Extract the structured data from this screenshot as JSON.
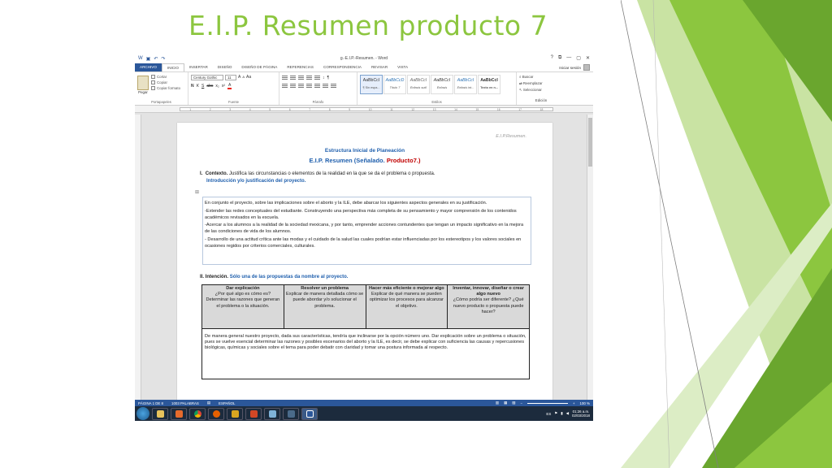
{
  "slide": {
    "title": "E.I.P. Resumen producto 7",
    "accent": "#8cc63f"
  },
  "word": {
    "doc_name": "g.-E.I.P.-Resumen. - Word",
    "win_ctrls": [
      "?",
      "⧉",
      "—",
      "▢",
      "✕"
    ],
    "tabs": [
      "ARCHIVO",
      "INICIO",
      "INSERTAR",
      "DISEÑO",
      "DISEÑO DE PÁGINA",
      "REFERENCIAS",
      "CORRESPONDENCIA",
      "REVISAR",
      "VISTA"
    ],
    "user": "Iniciar sesión",
    "ribbon": {
      "paste": "Pegar",
      "cut": "Cortar",
      "copy": "Copiar",
      "copy_format": "Copiar formato",
      "font_name": "Century Gothic",
      "font_size": "11",
      "groups": [
        "Portapapeles",
        "Fuente",
        "Párrafo",
        "Estilos",
        "Edición"
      ],
      "styles": [
        {
          "sample": "AaBbCcI",
          "name": "¶ Sin espa..."
        },
        {
          "sample": "AaBbCcD",
          "name": "Título 7"
        },
        {
          "sample": "AaBbCcI",
          "name": "Énfasis sutil"
        },
        {
          "sample": "AaBbCcI",
          "name": "Énfasis"
        },
        {
          "sample": "AaBbCcI",
          "name": "Énfasis int..."
        },
        {
          "sample": "AaBbCcI",
          "name": "Texto en n..."
        }
      ],
      "edit": [
        "Buscar",
        "Reemplazar",
        "Seleccionar"
      ]
    },
    "document": {
      "header_right": "E.I.P.Resumen.",
      "heading1": "Estructura Inicial de Planeación",
      "heading2_a": "E.I.P. Resumen (Señalado. ",
      "heading2_b": "Producto7.)",
      "section1_num": "I.",
      "section1_label": "Contexto.",
      "section1_text": "Justifica las circunstancias o elementos de la realidad en la que se da el problema o propuesta.",
      "section1_sub": "Introducción y/o justificación del proyecto.",
      "box_paragraphs": [
        "En conjunto el proyecto, sobre las implicaciones sobre el aborto y la ILE, debe abarcar los siguientes aspectos generales en su justificación.",
        "-Extender las redes conceptuales del estudiante. Construyendo una perspectiva más completa de su pensamiento y mayor comprensión de los contenidos académicos revisados en la escuela.",
        "-Acercar a los alumnos a la realidad de la sociedad mexicana, y por tanto, emprender acciones contundentes que tengan un impacto significativo en la mejora de las condiciones de vida de los alumnos.",
        "- Desarrollo de una actitud crítica ante las modas y el cuidado de la salud las cuales podrían estar influenciadas por los estereotipos y los valores sociales en ocasiones regidos por criterios comerciales, culturales."
      ],
      "section2_num": "II.",
      "section2_label": "Intención.",
      "section2_text": "Sólo una de las propuestas da nombre al proyecto.",
      "table_headers": [
        {
          "title": "Dar explicación",
          "text": "¿Por qué algo es cómo es? Determinar las razones que generan el problema o la situación."
        },
        {
          "title": "Resolver un problema",
          "text": "Explicar de manera detallada cómo se puede abordar y/o solucionar el problema."
        },
        {
          "title": "Hacer más eficiente o mejorar algo",
          "text": "Explicar de qué manera se pueden optimizar los procesos para alcanzar el objetivo."
        },
        {
          "title": "Inventar, innovar, diseñar o crear algo nuevo",
          "text": "¿Cómo podría ser diferente? ¿Qué nuevo producto o propuesta puede hacer?"
        }
      ],
      "table_body": "De manera general nuestro proyecto, dada sus características, tendría que inclinarse por la opción número uno. Dar explicación sobre un problema o situación, pues se vuelve esencial determinar las razones y posibles escenarios del aborto y la ILE, es decir, se debe explicar con suficiencia las causas y repercusiones biológicas, químicas y sociales sobre el tema para poder debatir con claridad y tomar una postura informada al respecto."
    },
    "status": {
      "page": "PÁGINA 1 DE 8",
      "words": "1003 PALABRAS",
      "lang": "ESPAÑOL",
      "zoom": "100 %"
    },
    "taskbar": {
      "lang": "ES",
      "time": "01:26 a.m.",
      "date": "02/03/2018"
    }
  }
}
